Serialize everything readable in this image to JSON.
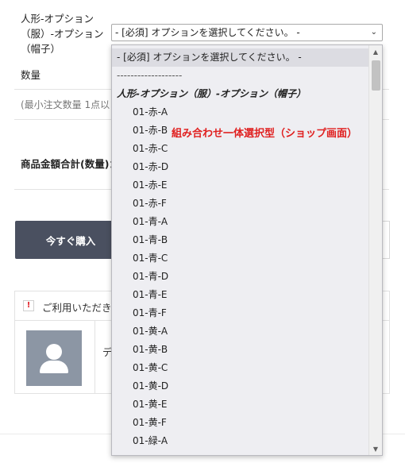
{
  "form": {
    "option_label": "人形-オプション（服）-オプション（帽子）",
    "quantity_label": "数量",
    "min_qty_text": "(最小注文数量 1点以",
    "total_label": "商品金額合計(数量)："
  },
  "select": {
    "current_value": "- [必須] オプションを選択してください。 -"
  },
  "dropdown": {
    "top_option": "- [必須] オプションを選択してください。 -",
    "separator": "-------------------",
    "group_label": "人形-オプション（服）-オプション（帽子）",
    "items": [
      "01-赤-A",
      "01-赤-B",
      "01-赤-C",
      "01-赤-D",
      "01-赤-E",
      "01-赤-F",
      "01-青-A",
      "01-青-B",
      "01-青-C",
      "01-青-D",
      "01-青-E",
      "01-青-F",
      "01-黄-A",
      "01-黄-B",
      "01-黄-C",
      "01-黄-D",
      "01-黄-E",
      "01-黄-F",
      "01-緑-A"
    ]
  },
  "annotation": "組み合わせ一体選択型（ショップ画面）",
  "buy_button": {
    "label": "今すぐ購入"
  },
  "notice": {
    "title": "ご利用いただき",
    "text": "デ"
  },
  "colors": {
    "buy_button_bg": "#4a5060",
    "annotation_color": "#e02020",
    "notice_mark_color": "#e1242a"
  },
  "icons": {
    "notice": "exclamation-icon",
    "avatar": "user-silhouette-icon",
    "select_arrow": "chevron-down-icon"
  }
}
